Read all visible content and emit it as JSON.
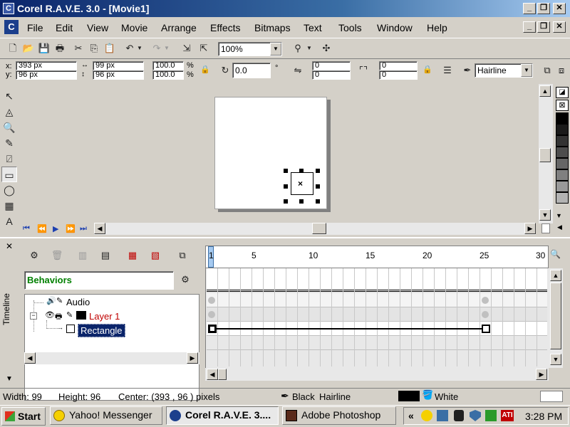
{
  "window": {
    "title": "Corel R.A.V.E. 3.0 - [Movie1]"
  },
  "menu": [
    "File",
    "Edit",
    "View",
    "Movie",
    "Arrange",
    "Effects",
    "Bitmaps",
    "Text",
    "Tools",
    "Window",
    "Help"
  ],
  "toolbar": {
    "zoom": "100%"
  },
  "propbar": {
    "x": "393 px",
    "y": "96 px",
    "w": "99 px",
    "h": "96 px",
    "scale_x": "100.0",
    "scale_y": "100.0",
    "pct": "%",
    "rotation": "0.0",
    "degree": "°",
    "corner_1": "0",
    "corner_2": "0",
    "corner_3": "0",
    "corner_4": "0",
    "outline": "Hairline",
    "x_label": "x:",
    "y_label": "y:"
  },
  "timeline": {
    "side_label": "Timeline",
    "behaviors": "Behaviors",
    "layers": [
      {
        "name": "Audio"
      },
      {
        "name": "Layer 1",
        "color": "#c00000"
      },
      {
        "name": "Rectangle"
      }
    ],
    "ruler": [
      "1",
      "5",
      "10",
      "15",
      "20",
      "25",
      "30"
    ]
  },
  "status": {
    "width": "Width: 99",
    "height": "Height: 96",
    "center": "Center: (393 , 96 ) pixels",
    "outline_color": "Black",
    "outline_width": "Hairline",
    "fill": "White"
  },
  "taskbar": {
    "start": "Start",
    "tasks": [
      "Yahoo! Messenger",
      "Corel R.A.V.E. 3....",
      "Adobe Photoshop"
    ],
    "clock": "3:28 PM"
  },
  "colors": {
    "title_start": "#0a246a",
    "selection": "#0a246a",
    "layer_red": "#c00000"
  }
}
